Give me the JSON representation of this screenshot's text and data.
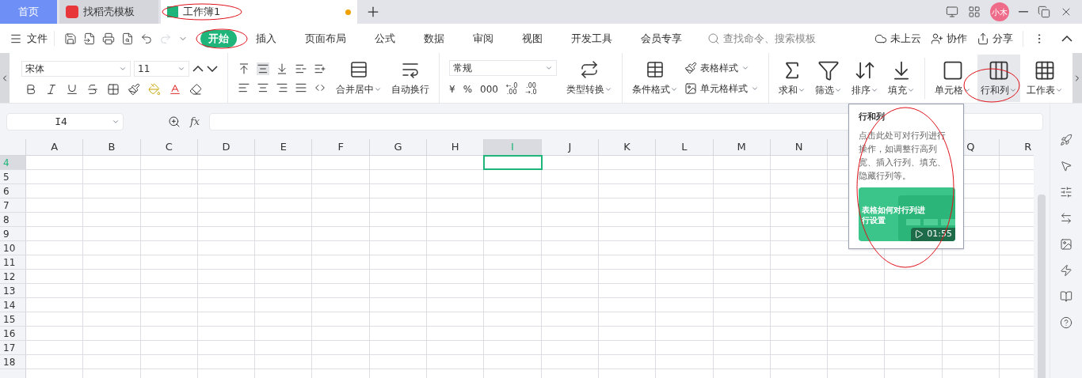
{
  "tabs": [
    {
      "label": "首页",
      "kind": "home",
      "selected": false
    },
    {
      "label": "找稻壳模板",
      "kind": "docer",
      "selected": false
    },
    {
      "label": "工作簿1",
      "kind": "sheet",
      "selected": true,
      "unsaved": true
    }
  ],
  "account": {
    "avatar": "小木"
  },
  "menu": {
    "file": "文件",
    "ribbon_tabs": [
      {
        "label": "开始",
        "selected": true
      },
      {
        "label": "插入",
        "selected": false
      },
      {
        "label": "页面布局",
        "selected": false
      },
      {
        "label": "公式",
        "selected": false
      },
      {
        "label": "数据",
        "selected": false
      },
      {
        "label": "审阅",
        "selected": false
      },
      {
        "label": "视图",
        "selected": false
      },
      {
        "label": "开发工具",
        "selected": false
      },
      {
        "label": "会员专享",
        "selected": false
      }
    ],
    "search": {
      "placeholder": "查找命令、搜索模板"
    },
    "actions": [
      "未上云",
      "协作",
      "分享"
    ]
  },
  "ribbon": {
    "font": "宋体",
    "font_size": "11",
    "merge": "合并居中",
    "wrap": "自动换行",
    "number_format": "常规",
    "number_buttons": [
      {
        "kind": "symbol",
        "label": "¥"
      },
      {
        "kind": "symbol",
        "label": "%"
      },
      {
        "kind": "symbol",
        "label": "000"
      },
      {
        "kind": "decimal",
        "top": "←.0",
        "bottom": ".00"
      },
      {
        "kind": "decimal",
        "top": ".00",
        "bottom": "→.0"
      }
    ],
    "convert": "类型转换",
    "conditional": "条件格式",
    "table_style": "表格样式",
    "cell_style": "单元格样式",
    "tools": [
      {
        "label": "求和",
        "kind": "sum",
        "selected": false
      },
      {
        "label": "筛选",
        "kind": "filter",
        "selected": false
      },
      {
        "label": "排序",
        "kind": "sort",
        "selected": false
      },
      {
        "label": "填充",
        "kind": "fill",
        "selected": false
      },
      {
        "label": "单元格",
        "kind": "cell",
        "selected": false
      },
      {
        "label": "行和列",
        "kind": "rowcol",
        "selected": true
      },
      {
        "label": "工作表",
        "kind": "sheet",
        "selected": false
      }
    ]
  },
  "formula_bar": {
    "name_box": "I4",
    "fx": "fx"
  },
  "grid": {
    "columns": [
      {
        "label": "A",
        "selected": false
      },
      {
        "label": "B",
        "selected": false
      },
      {
        "label": "C",
        "selected": false
      },
      {
        "label": "D",
        "selected": false
      },
      {
        "label": "E",
        "selected": false
      },
      {
        "label": "F",
        "selected": false
      },
      {
        "label": "G",
        "selected": false
      },
      {
        "label": "H",
        "selected": false
      },
      {
        "label": "I",
        "selected": true
      },
      {
        "label": "J",
        "selected": false
      },
      {
        "label": "K",
        "selected": false
      },
      {
        "label": "L",
        "selected": false
      },
      {
        "label": "M",
        "selected": false
      },
      {
        "label": "N",
        "selected": false
      },
      {},
      {},
      {
        "label": "Q",
        "selected": false
      },
      {
        "label": "R",
        "selected": false
      }
    ],
    "rows": [
      {
        "label": "4",
        "selected": true
      },
      {
        "label": "5",
        "selected": false
      },
      {
        "label": "6",
        "selected": false
      },
      {
        "label": "7",
        "selected": false
      },
      {
        "label": "8",
        "selected": false
      },
      {
        "label": "9",
        "selected": false
      },
      {
        "label": "10",
        "selected": false
      },
      {
        "label": "11",
        "selected": false
      },
      {
        "label": "12",
        "selected": false
      },
      {
        "label": "13",
        "selected": false
      },
      {
        "label": "14",
        "selected": false
      },
      {
        "label": "15",
        "selected": false
      },
      {
        "label": "16",
        "selected": false
      },
      {
        "label": "17",
        "selected": false
      },
      {
        "label": "18",
        "selected": false
      }
    ]
  },
  "tooltip": {
    "title": "行和列",
    "body": "点击此处可对行列进行操作，如调整行高列宽、插入行列、填充、隐藏行列等。",
    "video": {
      "title": "表格如何对行列进行设置",
      "duration": "01:55"
    }
  }
}
